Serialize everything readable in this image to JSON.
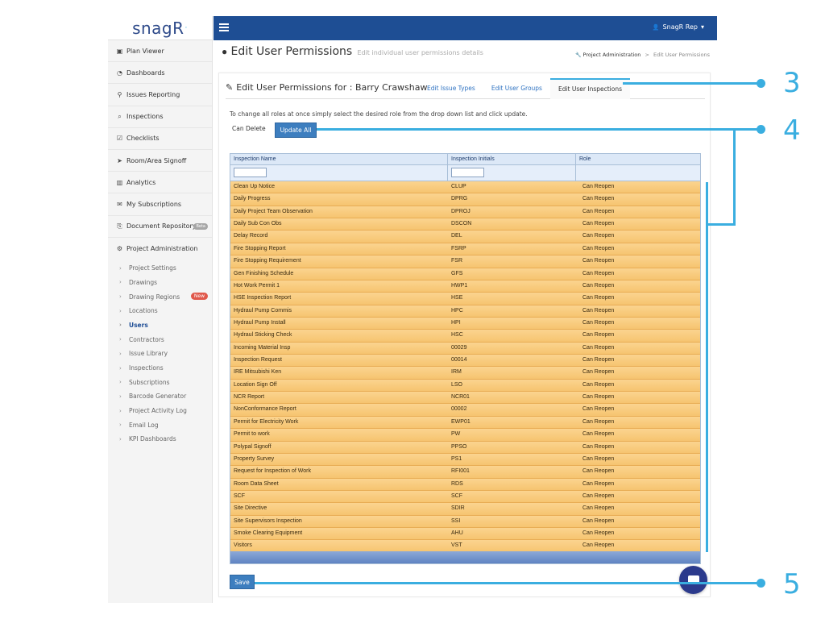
{
  "brand": {
    "name": "snagR",
    "mark": "·"
  },
  "sidebar": {
    "items": [
      {
        "label": "Plan Viewer",
        "icon": "▣"
      },
      {
        "label": "Dashboards",
        "icon": "◔"
      },
      {
        "label": "Issues Reporting",
        "icon": "⚲"
      },
      {
        "label": "Inspections",
        "icon": "⌕"
      },
      {
        "label": "Checklists",
        "icon": "☑"
      },
      {
        "label": "Room/Area Signoff",
        "icon": "➤"
      },
      {
        "label": "Analytics",
        "icon": "▥"
      },
      {
        "label": "My Subscriptions",
        "icon": "✉"
      },
      {
        "label": "Document Repository",
        "icon": "⎘",
        "badge": "Beta"
      },
      {
        "label": "Project Administration",
        "icon": "⚙"
      }
    ],
    "sub_items": [
      {
        "label": "Project Settings"
      },
      {
        "label": "Drawings"
      },
      {
        "label": "Drawing Regions",
        "badge": "New"
      },
      {
        "label": "Locations"
      },
      {
        "label": "Users"
      },
      {
        "label": "Contractors"
      },
      {
        "label": "Issue Library"
      },
      {
        "label": "Inspections"
      },
      {
        "label": "Subscriptions"
      },
      {
        "label": "Barcode Generator"
      },
      {
        "label": "Project Activity Log"
      },
      {
        "label": "Email Log"
      },
      {
        "label": "KPI Dashboards"
      }
    ]
  },
  "topbar": {
    "user": "SnagR Rep",
    "user_icon": "👤",
    "caret": "▾"
  },
  "header": {
    "title": "Edit User Permissions",
    "subtitle": "Edit individual user permissions details",
    "breadcrumb_main": "Project Administration",
    "breadcrumb_sep": ">",
    "breadcrumb_current": "Edit User Permissions",
    "wrench_icon": "🔧"
  },
  "panel": {
    "title": "Edit User Permissions for : Barry Crawshaw",
    "edit_icon": "✎",
    "tabs": [
      "Edit Issue Types",
      "Edit User Groups",
      "Edit User Inspections"
    ],
    "instruction": "To change all roles at once simply select the desired role from the drop down list and click update.",
    "role_value": "Can Delete",
    "update_label": "Update All",
    "save_label": "Save"
  },
  "grid": {
    "headers": [
      "Inspection Name",
      "Inspection Initials",
      "Role"
    ],
    "rows": [
      [
        "Clean Up Notice",
        "CLUP",
        "Can Reopen"
      ],
      [
        "Daily Progress",
        "DPRG",
        "Can Reopen"
      ],
      [
        "Daily Project Team Observation",
        "DPROJ",
        "Can Reopen"
      ],
      [
        "Daily Sub Con Obs",
        "DSCON",
        "Can Reopen"
      ],
      [
        "Delay Record",
        "DEL",
        "Can Reopen"
      ],
      [
        "Fire Stopping Report",
        "FSRP",
        "Can Reopen"
      ],
      [
        "Fire Stopping Requirement",
        "FSR",
        "Can Reopen"
      ],
      [
        "Gen Finishing Schedule",
        "GFS",
        "Can Reopen"
      ],
      [
        "Hot Work Permit 1",
        "HWP1",
        "Can Reopen"
      ],
      [
        "HSE Inspection Report",
        "HSE",
        "Can Reopen"
      ],
      [
        "Hydraul Pump Commis",
        "HPC",
        "Can Reopen"
      ],
      [
        "Hydraul Pump Install",
        "HPI",
        "Can Reopen"
      ],
      [
        "Hydraul Sticking Check",
        "HSC",
        "Can Reopen"
      ],
      [
        "Incoming Material Insp",
        "00029",
        "Can Reopen"
      ],
      [
        "Inspection Request",
        "00014",
        "Can Reopen"
      ],
      [
        "IRE Mitsubishi Ken",
        "IRM",
        "Can Reopen"
      ],
      [
        "Location Sign Off",
        "LSO",
        "Can Reopen"
      ],
      [
        "NCR Report",
        "NCR01",
        "Can Reopen"
      ],
      [
        "NonConformance Report",
        "00002",
        "Can Reopen"
      ],
      [
        "Permit for Electricity Work",
        "EWP01",
        "Can Reopen"
      ],
      [
        "Permit to work",
        "PW",
        "Can Reopen"
      ],
      [
        "Polypal Signoff",
        "PPSO",
        "Can Reopen"
      ],
      [
        "Property Survey",
        "PS1",
        "Can Reopen"
      ],
      [
        "Request for Inspection of Work",
        "RFI001",
        "Can Reopen"
      ],
      [
        "Room Data Sheet",
        "RDS",
        "Can Reopen"
      ],
      [
        "SCF",
        "SCF",
        "Can Reopen"
      ],
      [
        "Site Directive",
        "SDIR",
        "Can Reopen"
      ],
      [
        "Site Supervisors Inspection",
        "SSI",
        "Can Reopen"
      ],
      [
        "Smoke Clearing Equipment",
        "AHU",
        "Can Reopen"
      ],
      [
        "Visitors",
        "VST",
        "Can Reopen"
      ]
    ]
  },
  "annotations": [
    "3",
    "4",
    "5"
  ],
  "colors": {
    "brand_blue": "#1e4e94",
    "accent": "#3aaee0",
    "row_orange": "#f6c470",
    "new_badge": "#e0584b"
  }
}
